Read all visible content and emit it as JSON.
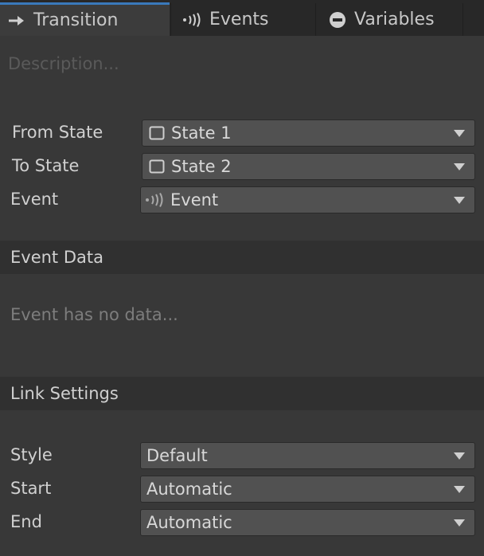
{
  "tabs": [
    {
      "label": "Transition",
      "icon": "arrow-right-icon",
      "active": true
    },
    {
      "label": "Events",
      "icon": "broadcast-icon",
      "active": false
    },
    {
      "label": "Variables",
      "icon": "minus-circle-icon",
      "active": false
    }
  ],
  "description": {
    "placeholder": "Description..."
  },
  "transition": {
    "from_state": {
      "label": "From State",
      "value": "State 1",
      "icon": "state-square-icon"
    },
    "to_state": {
      "label": "To State",
      "value": "State 2",
      "icon": "state-square-icon"
    },
    "event": {
      "label": "Event",
      "value": "Event",
      "icon": "broadcast-icon"
    }
  },
  "event_data": {
    "title": "Event Data",
    "empty_text": "Event has no data..."
  },
  "link_settings": {
    "title": "Link Settings",
    "style": {
      "label": "Style",
      "value": "Default"
    },
    "start": {
      "label": "Start",
      "value": "Automatic"
    },
    "end": {
      "label": "End",
      "value": "Automatic"
    }
  },
  "colors": {
    "accent": "#3a79bb",
    "background": "#383838",
    "field": "#515151"
  }
}
